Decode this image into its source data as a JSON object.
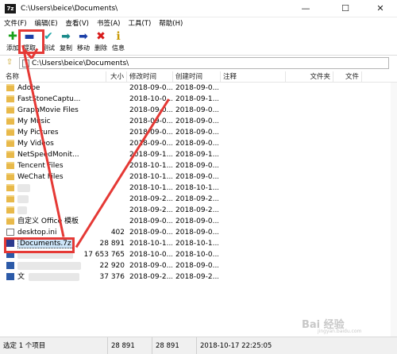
{
  "window": {
    "app_icon_text": "7z",
    "title": "C:\\Users\\beice\\Documents\\",
    "minimize_glyph": "—",
    "maximize_glyph": "☐",
    "close_glyph": "✕"
  },
  "menu": [
    "文件(F)",
    "编辑(E)",
    "查看(V)",
    "书签(A)",
    "工具(T)",
    "帮助(H)"
  ],
  "toolbar": [
    {
      "label": "添加",
      "icon": "plus-icon",
      "glyph": "✚",
      "color": "#1aa01a"
    },
    {
      "label": "提取",
      "icon": "minus-icon",
      "glyph": "▬",
      "color": "#1a3fa8"
    },
    {
      "label": "测试",
      "icon": "check-icon",
      "glyph": "✔",
      "color": "#1fa6a6"
    },
    {
      "label": "复制",
      "icon": "copy-arrow-icon",
      "glyph": "➡",
      "color": "#1a8a8a"
    },
    {
      "label": "移动",
      "icon": "move-arrow-icon",
      "glyph": "➡",
      "color": "#1a3fa8"
    },
    {
      "label": "删除",
      "icon": "delete-x-icon",
      "glyph": "✖",
      "color": "#d81b1b"
    },
    {
      "label": "信息",
      "icon": "info-icon",
      "glyph": "ℹ",
      "color": "#c99a06"
    }
  ],
  "address": {
    "up_glyph": "⇧",
    "path": "C:\\Users\\beice\\Documents\\"
  },
  "columns": [
    "名称",
    "大小",
    "修改时间",
    "创建时间",
    "注释",
    "文件夹",
    "文件"
  ],
  "rows": [
    {
      "name": "Adobe",
      "size": "",
      "modified": "2018-09-0...",
      "created": "2018-09-0...",
      "type": "folder"
    },
    {
      "name": "FastStoneCaptu...",
      "size": "",
      "modified": "2018-10-0...",
      "created": "2018-09-1...",
      "type": "folder"
    },
    {
      "name": "GraphMovie Files",
      "size": "",
      "modified": "2018-09-0...",
      "created": "2018-09-0...",
      "type": "folder"
    },
    {
      "name": "My Music",
      "size": "",
      "modified": "2018-09-0...",
      "created": "2018-09-0...",
      "type": "folder"
    },
    {
      "name": "My Pictures",
      "size": "",
      "modified": "2018-09-0...",
      "created": "2018-09-0...",
      "type": "folder"
    },
    {
      "name": "My Videos",
      "size": "",
      "modified": "2018-09-0...",
      "created": "2018-09-0...",
      "type": "folder"
    },
    {
      "name": "NetSpeedMonit...",
      "size": "",
      "modified": "2018-09-1...",
      "created": "2018-09-1...",
      "type": "folder"
    },
    {
      "name": "Tencent Files",
      "size": "",
      "modified": "2018-10-1...",
      "created": "2018-09-0...",
      "type": "folder"
    },
    {
      "name": "WeChat Files",
      "size": "",
      "modified": "2018-10-1...",
      "created": "2018-09-0...",
      "type": "folder"
    },
    {
      "name": "",
      "size": "",
      "modified": "2018-10-1...",
      "created": "2018-10-1...",
      "type": "folder"
    },
    {
      "name": "",
      "size": "",
      "modified": "2018-09-2...",
      "created": "2018-09-2...",
      "type": "folder"
    },
    {
      "name": "",
      "size": "",
      "modified": "2018-09-2...",
      "created": "2018-09-2...",
      "type": "folder"
    },
    {
      "name": "自定义 Office 模板",
      "size": "",
      "modified": "2018-09-0...",
      "created": "2018-09-0...",
      "type": "folder"
    },
    {
      "name": "desktop.ini",
      "size": "402",
      "modified": "2018-09-0...",
      "created": "2018-09-0...",
      "type": "file"
    },
    {
      "name": "Documents.7z",
      "size": "28 891",
      "modified": "2018-10-1...",
      "created": "2018-10-1...",
      "type": "7z"
    },
    {
      "name": "",
      "size": "17 653 765",
      "modified": "2018-10-0...",
      "created": "2018-10-0...",
      "type": "blue"
    },
    {
      "name": "",
      "size": "22 920",
      "modified": "2018-09-0...",
      "created": "2018-09-0...",
      "type": "blue"
    },
    {
      "name": "文",
      "size": "37 376",
      "modified": "2018-09-2...",
      "created": "2018-09-2...",
      "type": "blue"
    }
  ],
  "status": {
    "selection": "选定 1 个项目",
    "size1": "28 891",
    "size2": "28 891",
    "datetime": "2018-10-17 22:25:05"
  },
  "watermark": {
    "main": "Bai 经验",
    "sub": "jingyan.baidu.com"
  }
}
